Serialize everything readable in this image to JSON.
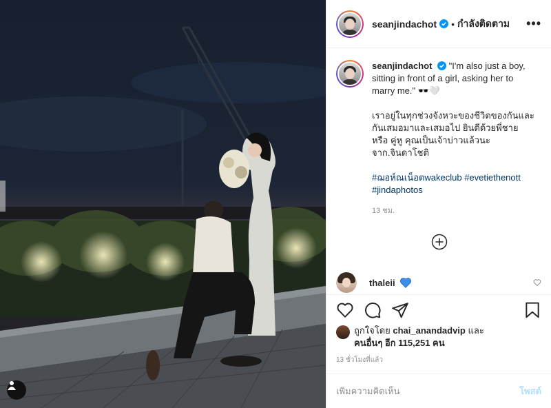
{
  "post": {
    "username": "seanjindachot",
    "verified": true,
    "follow_status": "กำลังติดตาม",
    "dot_separator": "•",
    "more_icon": "more-horizontal-icon",
    "caption": {
      "quote_line": "\"I'm also just a boy, sitting in front of a girl, asking her to marry me.\"",
      "emojis": "🕶️🤍",
      "thai_lines": [
        "เราอยู่ในทุกช่วงจังหวะของชีวิตของกันและ",
        "กันเสมอมาและเสมอไป ยินดีด้วยพี่ชาย",
        "หรือ คู่หู คุณเป็นเจ้าบ่าวแล้วนะ",
        "จาก.จินดาโชติ"
      ],
      "hashtags": [
        "#ฌอห์ณเน็อตwakeclub",
        "#evetiethenott",
        "#jindaphotos"
      ],
      "time": "13 ชม."
    },
    "comment": {
      "username": "thaleii",
      "emoji": "blue-heart"
    },
    "likes": {
      "prefix": "ถูกใจโดย",
      "liker": "chai_anandadvip",
      "and": "และ",
      "others": "คนอื่นๆ อีก 115,251 คน"
    },
    "post_time": "13 ชั่วโมงที่แล้ว",
    "add_comment_placeholder": "เพิ่มความคิดเห็น",
    "post_button": "โพสต์"
  },
  "colors": {
    "accent_blue": "#0095f6",
    "hashtag": "#00376b",
    "muted": "#8e8e8e",
    "post_disabled": "#b2dffc"
  }
}
